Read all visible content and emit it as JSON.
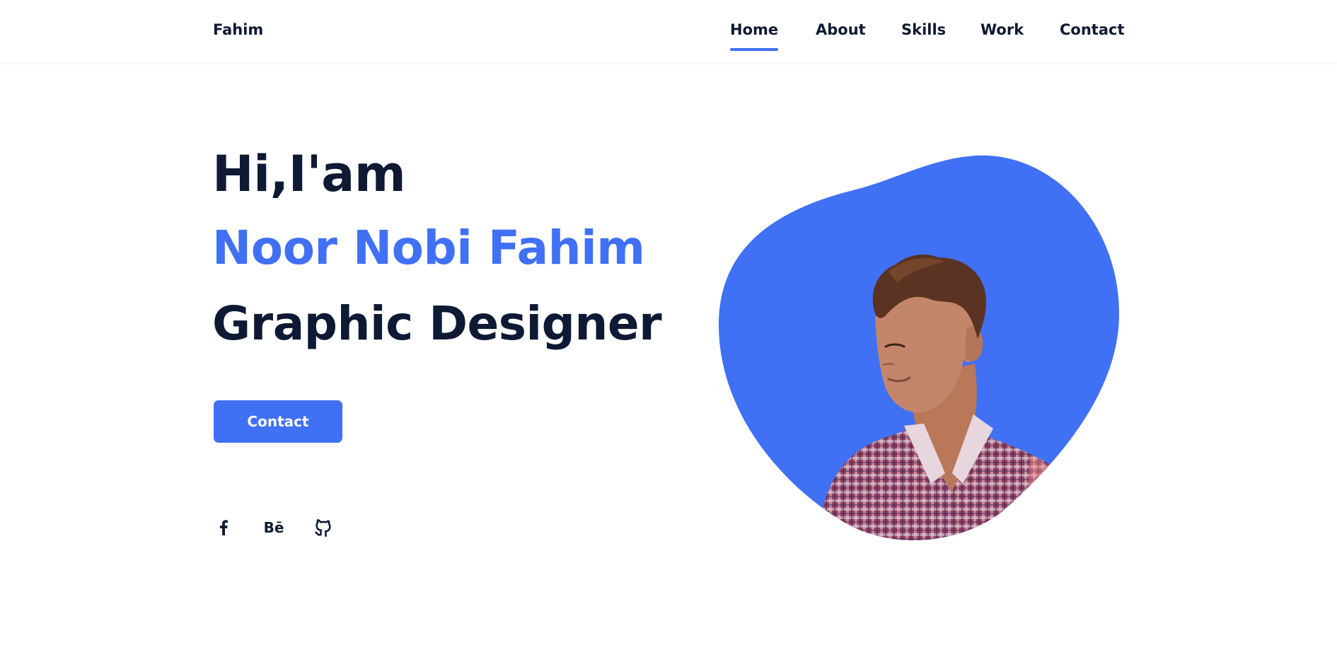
{
  "header": {
    "logo": "Fahim",
    "nav": [
      {
        "label": "Home",
        "active": true
      },
      {
        "label": "About",
        "active": false
      },
      {
        "label": "Skills",
        "active": false
      },
      {
        "label": "Work",
        "active": false
      },
      {
        "label": "Contact",
        "active": false
      }
    ]
  },
  "hero": {
    "greeting": "Hi,I'am",
    "name": "Noor Nobi Fahim",
    "role": "Graphic Designer",
    "contact_button": "Contact",
    "social": [
      {
        "icon": "facebook-icon",
        "text": ""
      },
      {
        "icon": "behance-icon",
        "text": "Bē"
      },
      {
        "icon": "github-icon",
        "text": ""
      }
    ],
    "image": {
      "icon": "portrait-photo"
    }
  },
  "colors": {
    "accent": "#4070f4",
    "text": "#0e1a33",
    "background": "#ffffff"
  }
}
